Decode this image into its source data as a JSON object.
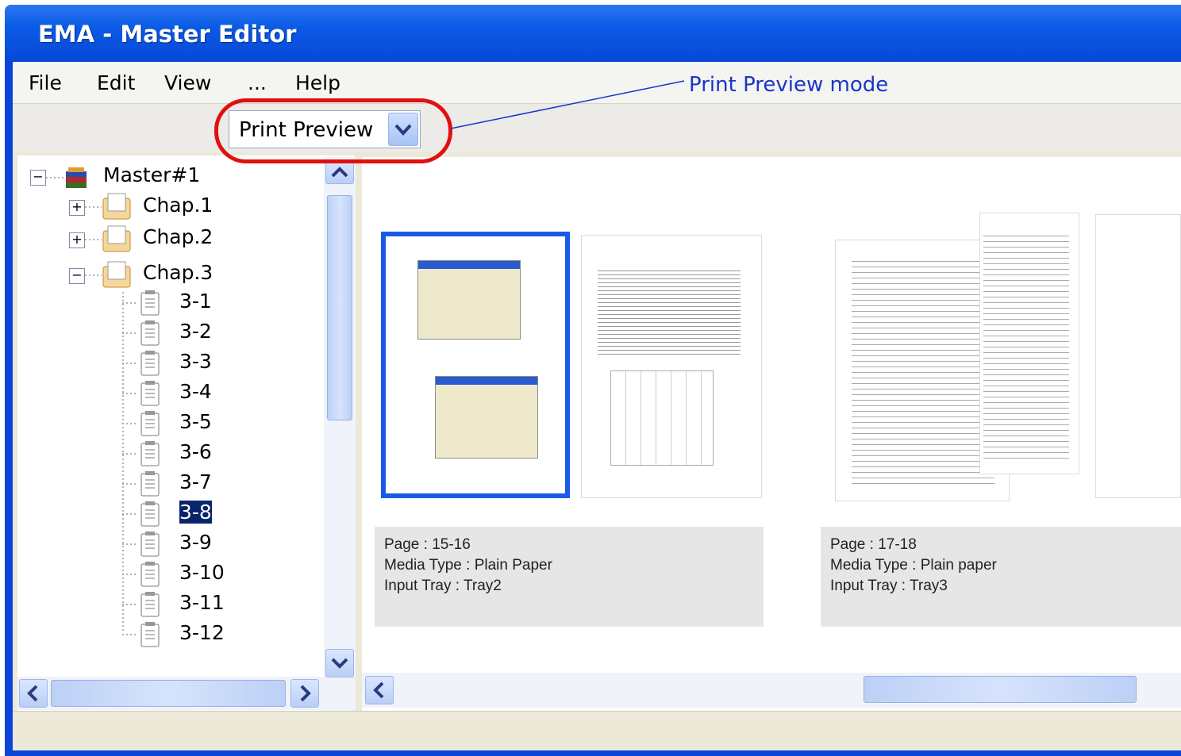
{
  "window": {
    "title": "EMA - Master Editor"
  },
  "menu": {
    "items": [
      "File",
      "Edit",
      "View",
      "...",
      "Help"
    ]
  },
  "toolbar": {
    "view_mode": "Print Preview"
  },
  "annotation": {
    "text": "Print  Preview mode",
    "color": "#1a35c8"
  },
  "tree": {
    "root": "Master#1",
    "chapters": [
      {
        "label": "Chap.1",
        "expanded": false
      },
      {
        "label": "Chap.2",
        "expanded": false
      },
      {
        "label": "Chap.3",
        "expanded": true
      }
    ],
    "sections": [
      "3-1",
      "3-2",
      "3-3",
      "3-4",
      "3-5",
      "3-6",
      "3-7",
      "3-8",
      "3-9",
      "3-10",
      "3-11",
      "3-12"
    ],
    "selected": "3-8"
  },
  "previews": [
    {
      "page": "Page : 15-16",
      "media": "Media Type :  Plain Paper",
      "tray": "Input Tray :  Tray2"
    },
    {
      "page": "Page :  17-18",
      "media": "Media Type : Plain paper",
      "tray": "Input Tray :  Tray3"
    }
  ],
  "icons": [
    "collapse-icon",
    "expand-icon",
    "master-stack-icon",
    "chapter-folder-icon",
    "section-document-icon",
    "chevron-down-icon",
    "chevron-up-icon",
    "chevron-left-icon",
    "chevron-right-icon"
  ],
  "colors": {
    "titlebar": "#0a5ae6",
    "selection": "#0a246a",
    "highlight": "#e01010"
  }
}
